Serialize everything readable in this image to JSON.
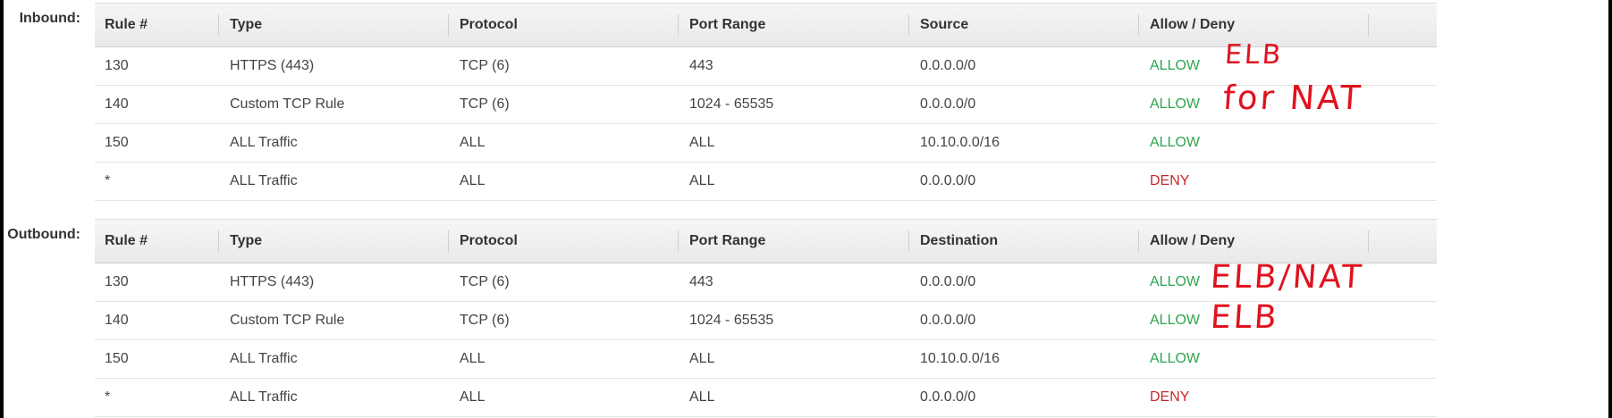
{
  "columns_inbound": [
    "Rule #",
    "Type",
    "Protocol",
    "Port Range",
    "Source",
    "Allow / Deny"
  ],
  "columns_outbound": [
    "Rule #",
    "Type",
    "Protocol",
    "Port Range",
    "Destination",
    "Allow / Deny"
  ],
  "inbound": {
    "label": "Inbound:",
    "rows": [
      {
        "rule": "130",
        "type": "HTTPS (443)",
        "protocol": "TCP (6)",
        "port": "443",
        "addr": "0.0.0.0/0",
        "action": "ALLOW"
      },
      {
        "rule": "140",
        "type": "Custom TCP Rule",
        "protocol": "TCP (6)",
        "port": "1024 - 65535",
        "addr": "0.0.0.0/0",
        "action": "ALLOW"
      },
      {
        "rule": "150",
        "type": "ALL Traffic",
        "protocol": "ALL",
        "port": "ALL",
        "addr": "10.10.0.0/16",
        "action": "ALLOW"
      },
      {
        "rule": "*",
        "type": "ALL Traffic",
        "protocol": "ALL",
        "port": "ALL",
        "addr": "0.0.0.0/0",
        "action": "DENY"
      }
    ]
  },
  "outbound": {
    "label": "Outbound:",
    "rows": [
      {
        "rule": "130",
        "type": "HTTPS (443)",
        "protocol": "TCP (6)",
        "port": "443",
        "addr": "0.0.0.0/0",
        "action": "ALLOW"
      },
      {
        "rule": "140",
        "type": "Custom TCP Rule",
        "protocol": "TCP (6)",
        "port": "1024 - 65535",
        "addr": "0.0.0.0/0",
        "action": "ALLOW"
      },
      {
        "rule": "150",
        "type": "ALL Traffic",
        "protocol": "ALL",
        "port": "ALL",
        "addr": "10.10.0.0/16",
        "action": "ALLOW"
      },
      {
        "rule": "*",
        "type": "ALL Traffic",
        "protocol": "ALL",
        "port": "ALL",
        "addr": "0.0.0.0/0",
        "action": "DENY"
      }
    ]
  },
  "annotations": {
    "inbound_130": "ELB",
    "inbound_140": "for NAT",
    "outbound_130": "ELB/NAT",
    "outbound_140": "ELB"
  },
  "colors": {
    "allow": "#2ea44f",
    "deny": "#c62828",
    "annotation": "#e0121d"
  }
}
